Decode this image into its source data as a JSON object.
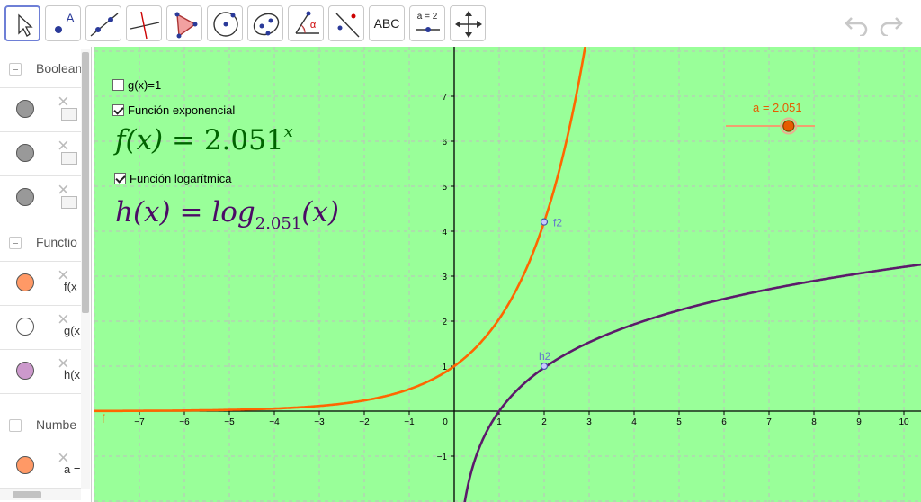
{
  "toolbar": {
    "tools": [
      {
        "name": "move-tool-button",
        "icon": "pointer-icon"
      },
      {
        "name": "point-tool-button",
        "icon": "point-icon",
        "text": "A"
      },
      {
        "name": "line-tool-button",
        "icon": "line-icon"
      },
      {
        "name": "perpendicular-tool-button",
        "icon": "perpendicular-line-icon"
      },
      {
        "name": "polygon-tool-button",
        "icon": "polygon-icon"
      },
      {
        "name": "circle-tool-button",
        "icon": "circle-icon"
      },
      {
        "name": "ellipse-tool-button",
        "icon": "ellipse-icon"
      },
      {
        "name": "angle-tool-button",
        "icon": "angle-icon",
        "text": "α"
      },
      {
        "name": "reflect-tool-button",
        "icon": "reflect-icon"
      },
      {
        "name": "text-tool-button",
        "icon": "text-icon",
        "text": "ABC"
      },
      {
        "name": "slider-tool-button",
        "icon": "slider-icon",
        "text": "a = 2"
      },
      {
        "name": "move-view-tool-button",
        "icon": "move-view-icon"
      }
    ],
    "undo_icon": "undo-icon",
    "redo_icon": "redo-icon"
  },
  "algebra": {
    "groups": {
      "boolean": "Boolean",
      "function": "Functio",
      "number": "Numbe"
    },
    "rows": [
      {
        "color": "#999999",
        "text": ""
      },
      {
        "color": "#999999",
        "text": ""
      },
      {
        "color": "#999999",
        "text": ""
      },
      {
        "color": "#ff9966",
        "text": "f(x"
      },
      {
        "color": "#ffffff",
        "text": "g(x"
      },
      {
        "color": "#cc99cc",
        "text": "h(x"
      },
      {
        "color": "#ff9966",
        "text": "a ="
      }
    ]
  },
  "graphics": {
    "background": "#99ff99",
    "checkbox_g": {
      "label": "g(x)=1",
      "checked": false
    },
    "checkbox_f": {
      "label": "Función exponencial",
      "checked": true
    },
    "checkbox_h": {
      "label": "Función logarítmica",
      "checked": true
    },
    "formula_f": {
      "lhs": "f(x) = ",
      "base": "2.051",
      "exp": "x"
    },
    "formula_h": {
      "lhs": "h(x) = log",
      "base": "2.051",
      "rhs": "(x)"
    },
    "slider": {
      "label": "a = 2.051",
      "value": 2.051,
      "min": -5,
      "max": 5,
      "color": "#e65c00"
    },
    "axes": {
      "x_ticks": [
        "−7",
        "−6",
        "−5",
        "−4",
        "−3",
        "−2",
        "−1",
        "0",
        "1",
        "2",
        "3",
        "4",
        "5",
        "6",
        "7",
        "8",
        "9",
        "10"
      ],
      "y_ticks": [
        "7",
        "6",
        "5",
        "4",
        "3",
        "2",
        "1",
        "−1"
      ]
    },
    "curves": {
      "f": {
        "label": "f",
        "color": "#ff6600",
        "base": 2.051
      },
      "h": {
        "color": "#5c1a6b",
        "base": 2.051
      }
    },
    "points": {
      "f2": {
        "label": "f2",
        "x": 2,
        "y": 4.207
      },
      "h2": {
        "label": "h2",
        "x": 2,
        "y": 1
      }
    }
  }
}
